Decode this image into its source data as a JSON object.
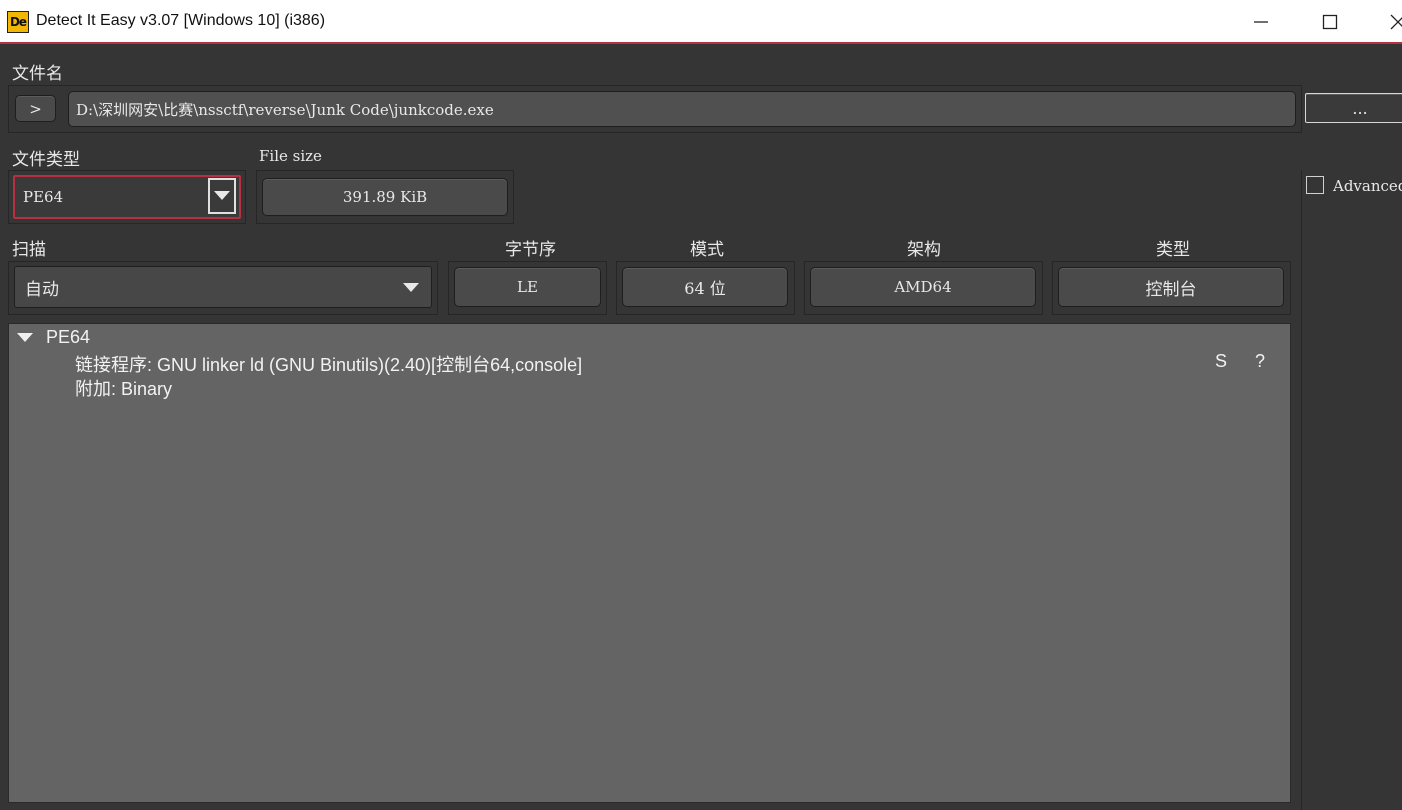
{
  "window": {
    "title": "Detect It Easy v3.07 [Windows 10] (i386)",
    "icon_text": "De",
    "icon": "die-app-icon",
    "controls": [
      "minimize-icon",
      "maximize-icon",
      "close-icon"
    ]
  },
  "file": {
    "label": "文件名",
    "expand_glyph": ">",
    "path": "D:\\深圳网安\\比赛\\nssctf\\reverse\\Junk Code\\junkcode.exe",
    "browse_label": "..."
  },
  "file_type": {
    "label": "文件类型",
    "value": "PE64"
  },
  "file_size": {
    "label": "File size",
    "value": "391.89 KiB"
  },
  "advanced": {
    "label": "Advanced",
    "checked": false
  },
  "scan": {
    "label": "扫描",
    "value": "自动"
  },
  "info": {
    "endian": {
      "label": "字节序",
      "value": "LE"
    },
    "mode": {
      "label": "模式",
      "value": "64 位"
    },
    "arch": {
      "label": "架构",
      "value": "AMD64"
    },
    "type": {
      "label": "类型",
      "value": "控制台"
    }
  },
  "results": {
    "root": "PE64",
    "rows": [
      {
        "text": "链接程序: GNU linker ld (GNU Binutils)(2.40)[控制台64,console]",
        "s": "S",
        "q": "?"
      },
      {
        "text": "附加: Binary"
      }
    ]
  },
  "colors": {
    "background": "#353535",
    "result_bg": "#646464",
    "accent_red": "#b7303f"
  }
}
